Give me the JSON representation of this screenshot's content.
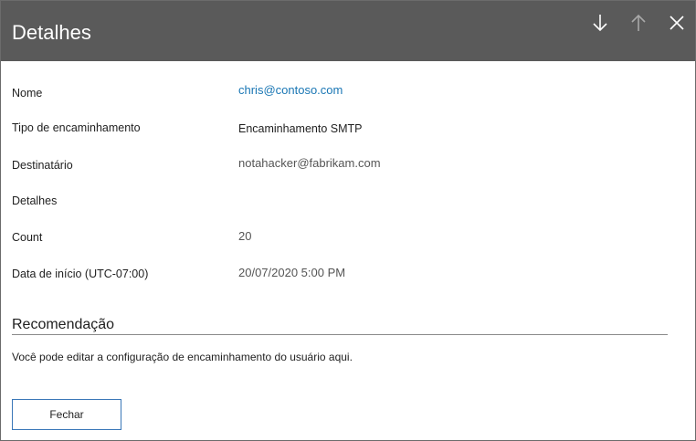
{
  "header": {
    "title": "Detalhes",
    "icons": [
      "arrow-down-icon",
      "arrow-up-icon",
      "close-icon"
    ],
    "background_color": "#5a5a5a"
  },
  "details": [
    {
      "label": "Nome",
      "value": "chris@contoso.com"
    },
    {
      "label": "Tipo de encaminhamento",
      "value": "Encaminhamento SMTP"
    },
    {
      "label": "Destinatário",
      "value": "notahacker@fabrikam.com"
    },
    {
      "label": "Detalhes",
      "value": ""
    },
    {
      "label": "Count",
      "value": "20"
    },
    {
      "label": "Data de início (UTC-07:00)",
      "value": "20/07/2020 5:00 PM"
    }
  ],
  "recommendation": {
    "title": "Recomendação",
    "text": "Você pode editar a configuração de encaminhamento do usuário aqui."
  },
  "footer": {
    "close_label": "Fechar"
  },
  "colors": {
    "link": "#1976b4",
    "button_border": "#3a77b8"
  }
}
